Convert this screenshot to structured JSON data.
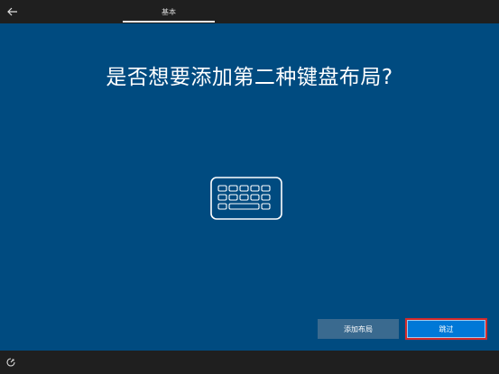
{
  "topbar": {
    "back_icon": "arrow-left-icon",
    "tab_label": "基本"
  },
  "main": {
    "title": "是否想要添加第二种键盘布局?",
    "illustration_icon": "keyboard-icon",
    "add_layout_label": "添加布局",
    "skip_label": "跳过"
  },
  "bottombar": {
    "accessibility_icon": "ease-of-access-icon"
  },
  "colors": {
    "background": "#004b80",
    "bars": "#1f1f1f",
    "primary_button": "#0078d7",
    "secondary_button": "#3a6a8f",
    "highlight_border": "#d42a2a"
  }
}
